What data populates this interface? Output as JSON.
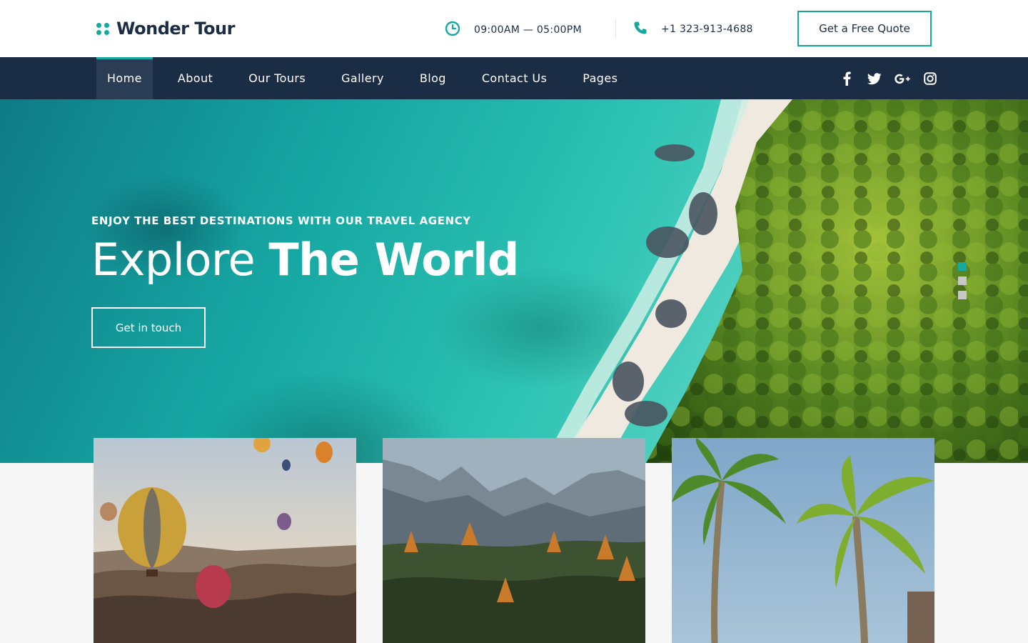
{
  "brand": {
    "name": "Wonder Tour",
    "accent": "#16a9a0",
    "navy": "#1b2d45"
  },
  "header": {
    "hours": "09:00AM — 05:00PM",
    "phone": "+1 323-913-4688",
    "quote_button": "Get a Free Quote",
    "icons": [
      "clock-icon",
      "phone-icon"
    ]
  },
  "nav": {
    "items": [
      {
        "label": "Home",
        "active": true
      },
      {
        "label": "About"
      },
      {
        "label": "Our Tours"
      },
      {
        "label": "Gallery"
      },
      {
        "label": "Blog"
      },
      {
        "label": "Contact Us"
      },
      {
        "label": "Pages"
      }
    ],
    "social": [
      "facebook-icon",
      "twitter-icon",
      "google-plus-icon",
      "instagram-icon"
    ]
  },
  "hero": {
    "kicker": "ENJOY THE BEST DESTINATIONS WITH OUR TRAVEL AGENCY",
    "title_light": "Explore",
    "title_bold": "The World",
    "button": "Get in touch",
    "slides": 3,
    "active_slide": 1
  },
  "cards": [
    {
      "image": "hot-air-balloons"
    },
    {
      "image": "mountain-forest"
    },
    {
      "image": "palm-trees"
    }
  ]
}
